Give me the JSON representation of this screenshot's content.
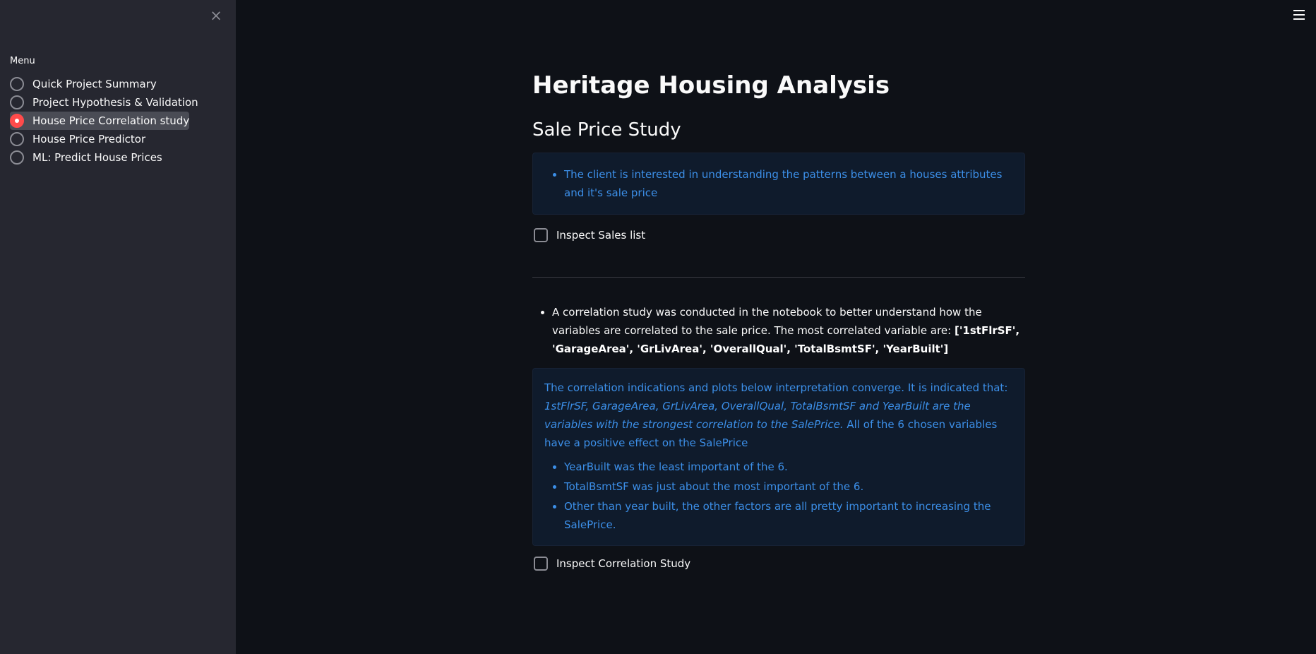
{
  "sidebar": {
    "close_icon": "×",
    "menu_label": "Menu",
    "items": [
      {
        "label": "Quick Project Summary",
        "selected": false
      },
      {
        "label": "Project Hypothesis & Validation",
        "selected": false
      },
      {
        "label": "House Price Correlation study",
        "selected": true
      },
      {
        "label": "House Price Predictor",
        "selected": false
      },
      {
        "label": "ML: Predict House Prices",
        "selected": false
      }
    ]
  },
  "header": {
    "menu_icon": "hamburger-icon"
  },
  "main": {
    "title": "Heritage Housing Analysis",
    "subtitle": "Sale Price Study",
    "info1": "The client is interested in understanding the patterns between a houses attributes and it's sale price",
    "checkbox1_label": "Inspect Sales list",
    "bullet_text": "A correlation study was conducted in the notebook to better understand how the variables are correlated to the sale price. The most correlated variable are:",
    "bullet_bold": "['1stFlrSF', 'GarageArea', 'GrLivArea', 'OverallQual', 'TotalBsmtSF', 'YearBuilt']",
    "info2": {
      "intro": "The correlation indications and plots below interpretation converge. It is indicated that:",
      "italic": "1stFlrSF, GarageArea, GrLivArea, OverallQual, TotalBsmtSF and YearBuilt are the variables with the strongest correlation to the SalePrice.",
      "outro": "All of the 6 chosen variables have a positive effect on the SalePrice",
      "points": [
        "YearBuilt was the least important of the 6.",
        "TotalBsmtSF was just about the most important of the 6.",
        "Other than year built, the other factors are all pretty important to increasing the SalePrice."
      ]
    },
    "checkbox2_label": "Inspect Correlation Study"
  },
  "colors": {
    "sidebar_bg": "#262730",
    "main_bg": "#0e1117",
    "accent": "#ff4b4b",
    "info_text": "#3c8fe8",
    "info_bg": "#0f1b2c"
  }
}
